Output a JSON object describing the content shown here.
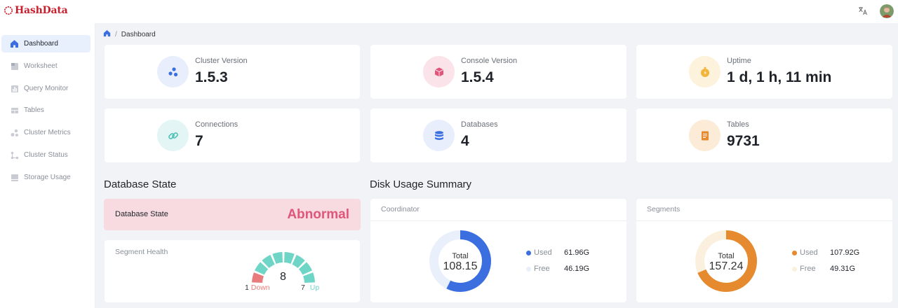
{
  "app": {
    "logo_text": "HashData"
  },
  "header": {
    "translate_icon": "translate-icon",
    "avatar_icon": "user-avatar"
  },
  "sidebar": {
    "items": [
      {
        "label": "Dashboard",
        "icon": "home-icon",
        "active": true
      },
      {
        "label": "Worksheet",
        "icon": "worksheet-icon"
      },
      {
        "label": "Query Monitor",
        "icon": "bar-chart-icon"
      },
      {
        "label": "Tables",
        "icon": "table-icon"
      },
      {
        "label": "Cluster Metrics",
        "icon": "metrics-icon"
      },
      {
        "label": "Cluster Status",
        "icon": "status-icon"
      },
      {
        "label": "Storage Usage",
        "icon": "storage-icon"
      }
    ]
  },
  "breadcrumb": {
    "home_icon": "home-icon",
    "separator": "/",
    "current": "Dashboard"
  },
  "stats": [
    {
      "label": "Cluster Version",
      "value": "1.5.3",
      "icon": "cluster-icon",
      "icon_bg": "#e8eefb",
      "icon_color": "#3b6fe0"
    },
    {
      "label": "Console Version",
      "value": "1.5.4",
      "icon": "cube-icon",
      "icon_bg": "#fbe3ea",
      "icon_color": "#e0557a"
    },
    {
      "label": "Uptime",
      "value": "1 d, 1 h, 11 min",
      "icon": "stopwatch-icon",
      "icon_bg": "#fdf3dc",
      "icon_color": "#f2b43a"
    },
    {
      "label": "Connections",
      "value": "7",
      "icon": "link-icon",
      "icon_bg": "#e3f6f5",
      "icon_color": "#4cc1b6"
    },
    {
      "label": "Databases",
      "value": "4",
      "icon": "database-icon",
      "icon_bg": "#e8eefb",
      "icon_color": "#3b6fe0"
    },
    {
      "label": "Tables",
      "value": "9731",
      "icon": "document-icon",
      "icon_bg": "#fbebd7",
      "icon_color": "#e58a2e"
    }
  ],
  "database_state": {
    "section_title": "Database State",
    "label": "Database State",
    "value": "Abnormal"
  },
  "segment_health": {
    "title": "Segment Health",
    "total": "8",
    "down_count": "1",
    "down_label": "Down",
    "up_count": "7",
    "up_label": "Up",
    "down_fraction": 0.125,
    "down_color": "#e87c7c",
    "up_color": "#6fd6c7"
  },
  "disk_usage": {
    "section_title": "Disk Usage Summary",
    "coordinator": {
      "title": "Coordinator",
      "total_label": "Total",
      "total": "108.15",
      "used_label": "Used",
      "used": "61.96G",
      "free_label": "Free",
      "free": "46.19G",
      "used_value": 61.96,
      "free_value": 46.19,
      "used_color": "#3b6fe0",
      "free_color": "#e9effb"
    },
    "segments": {
      "title": "Segments",
      "total_label": "Total",
      "total": "157.24",
      "used_label": "Used",
      "used": "107.92G",
      "free_label": "Free",
      "free": "49.31G",
      "used_value": 107.92,
      "free_value": 49.31,
      "used_color": "#e58a2e",
      "free_color": "#fbf0dd"
    }
  }
}
